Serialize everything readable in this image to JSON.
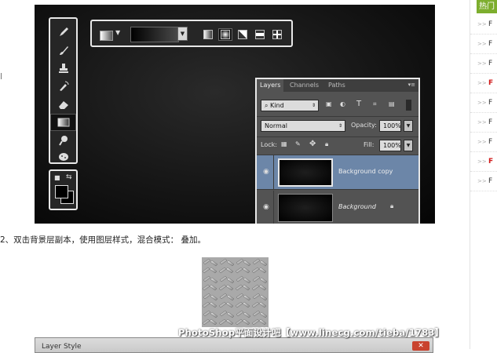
{
  "sidebar": {
    "tab_label": "热门",
    "items": [
      {
        "arrow": ">>",
        "text": "F",
        "red": false
      },
      {
        "arrow": ">>",
        "text": "F",
        "red": false
      },
      {
        "arrow": ">>",
        "text": "F",
        "red": false
      },
      {
        "arrow": ">>",
        "text": "F",
        "red": true
      },
      {
        "arrow": ">>",
        "text": "F",
        "red": false
      },
      {
        "arrow": ">>",
        "text": "F",
        "red": false
      },
      {
        "arrow": ">>",
        "text": "F",
        "red": false
      },
      {
        "arrow": ">>",
        "text": "F",
        "red": true
      },
      {
        "arrow": ">>",
        "text": "F",
        "red": false
      }
    ]
  },
  "toolbar_icons": [
    "pencil-icon",
    "brush-icon",
    "stamp-icon",
    "history-brush-icon",
    "eraser-icon",
    "gradient-icon",
    "smudge-icon",
    "sponge-icon"
  ],
  "gradient_types": [
    "linear-gradient-icon",
    "radial-gradient-icon",
    "angle-gradient-icon",
    "reflected-gradient-icon",
    "diamond-gradient-icon"
  ],
  "layers_panel": {
    "tabs": [
      "Layers",
      "Channels",
      "Paths"
    ],
    "kind_label": "Kind",
    "blend_mode": "Normal",
    "opacity_label": "Opacity:",
    "opacity_value": "100%",
    "lock_label": "Lock:",
    "fill_label": "Fill:",
    "fill_value": "100%",
    "layers": [
      {
        "name": "Background copy",
        "selected": true
      },
      {
        "name": "Background",
        "selected": false,
        "locked": true
      }
    ]
  },
  "caption": "2、双击背景层副本，使用图层样式，混合模式：  叠加。",
  "watermark": "PhotoShop平面设计吧【www.linecg.com/tieba/1783】",
  "dialog": {
    "title": "Layer Style",
    "close": "✕"
  },
  "colors": {
    "sidebar_tab": "#7dae2e",
    "selected_layer": "#6c86a8",
    "red_link": "#d01a1a"
  }
}
